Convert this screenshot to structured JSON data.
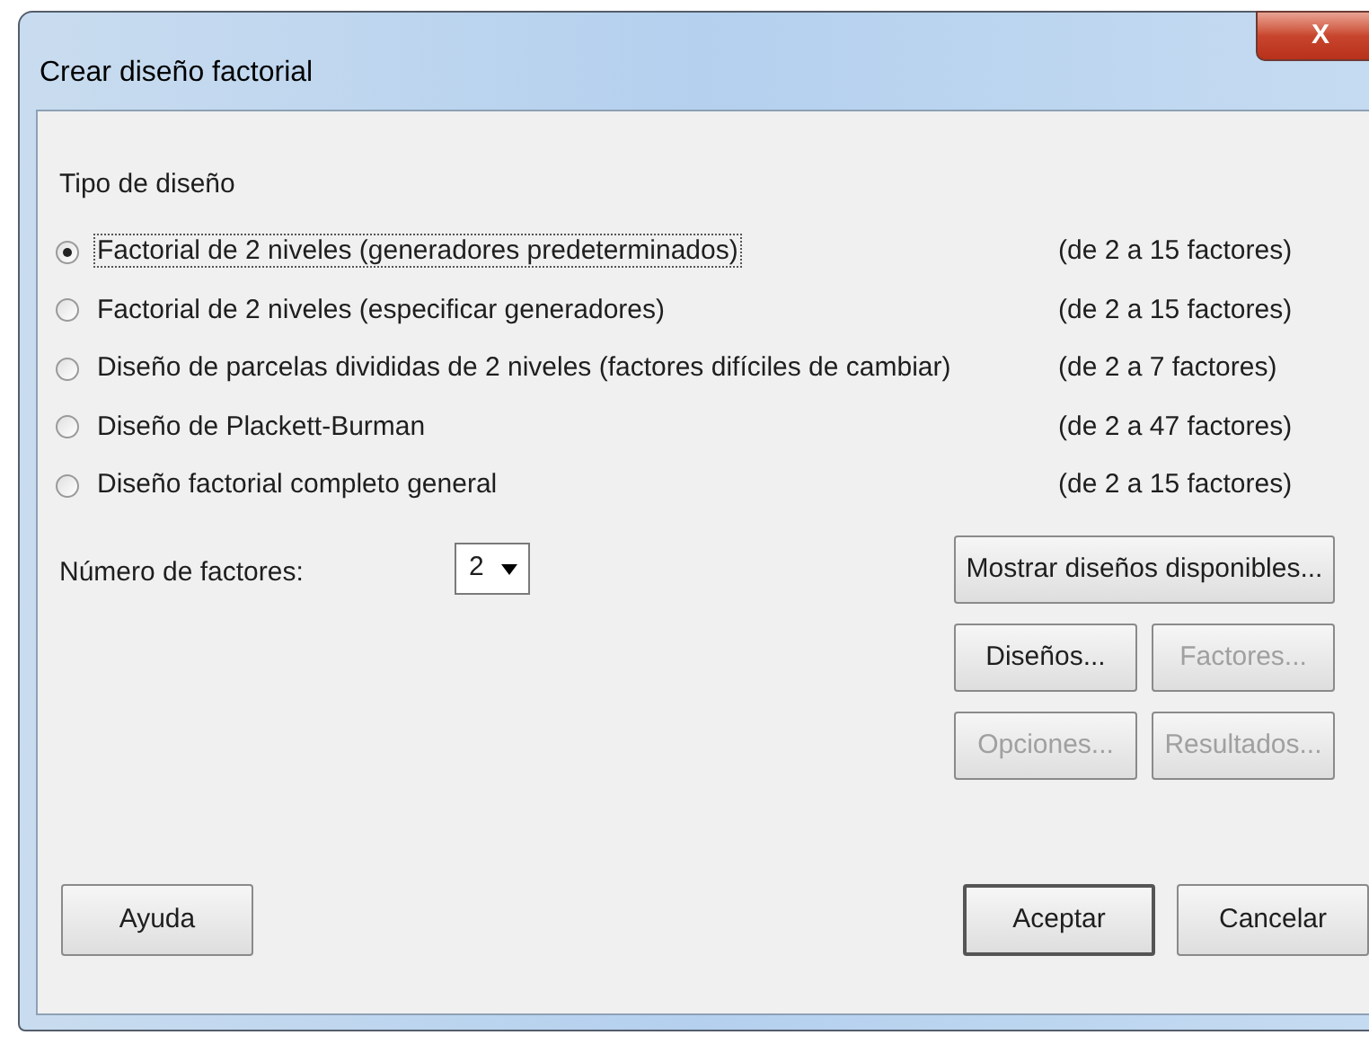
{
  "window": {
    "title": "Crear diseño factorial",
    "close": "X"
  },
  "design_type": {
    "label": "Tipo de diseño",
    "options": [
      {
        "label": "Factorial de 2 niveles (generadores predeterminados)",
        "range": "(de 2 a 15 factores)",
        "selected": true
      },
      {
        "label": "Factorial de 2 niveles (especificar generadores)",
        "range": "(de 2 a 15 factores)",
        "selected": false
      },
      {
        "label": "Diseño de parcelas divididas de 2 niveles (factores difíciles de cambiar)",
        "range": "(de 2 a 7 factores)",
        "selected": false
      },
      {
        "label": "Diseño de Plackett-Burman",
        "range": "(de 2 a 47 factores)",
        "selected": false
      },
      {
        "label": "Diseño factorial completo general",
        "range": "(de 2 a 15 factores)",
        "selected": false
      }
    ]
  },
  "factors": {
    "label": "Número de factores:",
    "value": "2"
  },
  "side_buttons": [
    {
      "label": "Mostrar diseños disponibles...",
      "disabled": false
    },
    {
      "label": "Diseños...",
      "disabled": false
    },
    {
      "label": "Factores...",
      "disabled": true
    },
    {
      "label": "Opciones...",
      "disabled": true
    },
    {
      "label": "Resultados...",
      "disabled": true
    }
  ],
  "bottom_buttons": [
    {
      "label": "Ayuda",
      "default": false
    },
    {
      "label": "Aceptar",
      "default": true
    },
    {
      "label": "Cancelar",
      "default": false
    }
  ]
}
